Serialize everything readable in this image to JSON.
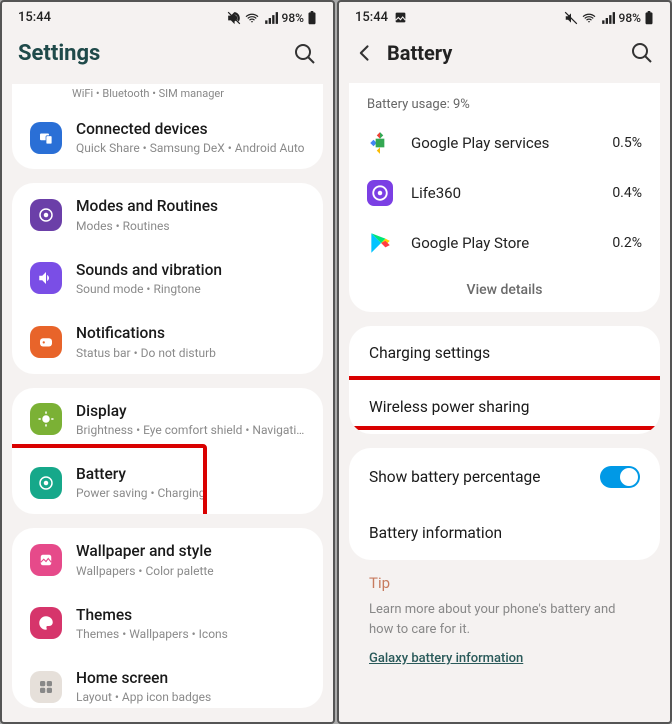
{
  "status": {
    "time": "15:44",
    "image_indicator": "true",
    "battery_text": "98%"
  },
  "left": {
    "header_title": "Settings",
    "peek_text": "WiFi  •  Bluetooth  •  SIM manager",
    "groups": [
      {
        "items": [
          {
            "icon": "connected",
            "bg": "#2a6fd6",
            "title": "Connected devices",
            "sub": "Quick Share  •  Samsung DeX  •  Android Auto"
          }
        ]
      },
      {
        "items": [
          {
            "icon": "modes",
            "bg": "#6b3fa8",
            "title": "Modes and Routines",
            "sub": "Modes  •  Routines"
          },
          {
            "icon": "sound",
            "bg": "#7a4ee6",
            "title": "Sounds and vibration",
            "sub": "Sound mode  •  Ringtone"
          },
          {
            "icon": "notif",
            "bg": "#e8642a",
            "title": "Notifications",
            "sub": "Status bar  •  Do not disturb"
          }
        ]
      },
      {
        "items": [
          {
            "icon": "display",
            "bg": "#7bb135",
            "title": "Display",
            "sub": "Brightness  •  Eye comfort shield  •  Navigation bar"
          },
          {
            "icon": "battery",
            "bg": "#16a88a",
            "title": "Battery",
            "sub": "Power saving  •  Charging",
            "highlight": true
          }
        ]
      },
      {
        "items": [
          {
            "icon": "wallpaper",
            "bg": "#e64a8a",
            "title": "Wallpaper and style",
            "sub": "Wallpapers  •  Color palette"
          },
          {
            "icon": "themes",
            "bg": "#d6356b",
            "title": "Themes",
            "sub": "Themes  •  Wallpapers  •  Icons"
          },
          {
            "icon": "home",
            "bg": "#e6e0da",
            "title": "Home screen",
            "sub": "Layout  •  App icon badges"
          }
        ]
      }
    ]
  },
  "right": {
    "header_title": "Battery",
    "usage_label": "Battery usage: 9%",
    "apps": [
      {
        "name": "Google Play services",
        "pct": "0.5%",
        "color": "#34a853"
      },
      {
        "name": "Life360",
        "pct": "0.4%",
        "color": "#7b3fe4"
      },
      {
        "name": "Google Play Store",
        "pct": "0.2%",
        "color": "#fff"
      }
    ],
    "view_details": "View details",
    "rows": {
      "charging": "Charging settings",
      "wireless": "Wireless power sharing",
      "show_pct": "Show battery percentage",
      "info": "Battery information"
    },
    "tip": {
      "title": "Tip",
      "body": "Learn more about your phone's battery and how to care for it.",
      "link": "Galaxy battery information"
    }
  }
}
